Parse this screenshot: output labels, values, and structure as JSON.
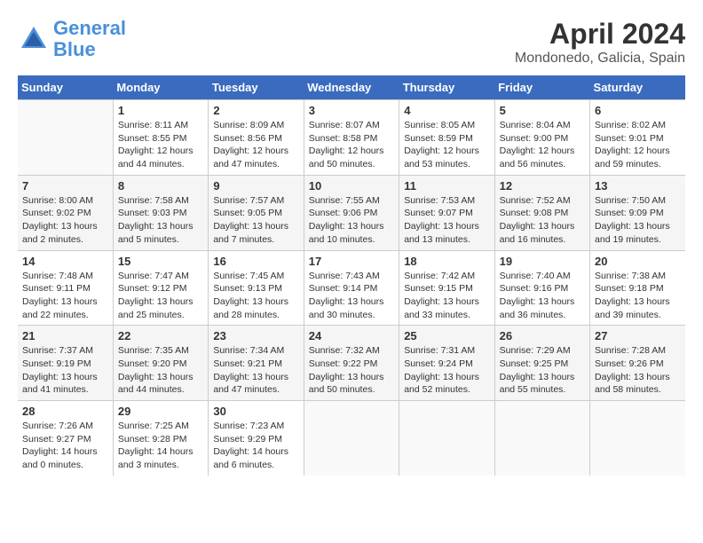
{
  "header": {
    "logo_line1": "General",
    "logo_line2": "Blue",
    "title": "April 2024",
    "subtitle": "Mondonedo, Galicia, Spain"
  },
  "days_of_week": [
    "Sunday",
    "Monday",
    "Tuesday",
    "Wednesday",
    "Thursday",
    "Friday",
    "Saturday"
  ],
  "weeks": [
    [
      {
        "day": "",
        "info": ""
      },
      {
        "day": "1",
        "info": "Sunrise: 8:11 AM\nSunset: 8:55 PM\nDaylight: 12 hours\nand 44 minutes."
      },
      {
        "day": "2",
        "info": "Sunrise: 8:09 AM\nSunset: 8:56 PM\nDaylight: 12 hours\nand 47 minutes."
      },
      {
        "day": "3",
        "info": "Sunrise: 8:07 AM\nSunset: 8:58 PM\nDaylight: 12 hours\nand 50 minutes."
      },
      {
        "day": "4",
        "info": "Sunrise: 8:05 AM\nSunset: 8:59 PM\nDaylight: 12 hours\nand 53 minutes."
      },
      {
        "day": "5",
        "info": "Sunrise: 8:04 AM\nSunset: 9:00 PM\nDaylight: 12 hours\nand 56 minutes."
      },
      {
        "day": "6",
        "info": "Sunrise: 8:02 AM\nSunset: 9:01 PM\nDaylight: 12 hours\nand 59 minutes."
      }
    ],
    [
      {
        "day": "7",
        "info": "Sunrise: 8:00 AM\nSunset: 9:02 PM\nDaylight: 13 hours\nand 2 minutes."
      },
      {
        "day": "8",
        "info": "Sunrise: 7:58 AM\nSunset: 9:03 PM\nDaylight: 13 hours\nand 5 minutes."
      },
      {
        "day": "9",
        "info": "Sunrise: 7:57 AM\nSunset: 9:05 PM\nDaylight: 13 hours\nand 7 minutes."
      },
      {
        "day": "10",
        "info": "Sunrise: 7:55 AM\nSunset: 9:06 PM\nDaylight: 13 hours\nand 10 minutes."
      },
      {
        "day": "11",
        "info": "Sunrise: 7:53 AM\nSunset: 9:07 PM\nDaylight: 13 hours\nand 13 minutes."
      },
      {
        "day": "12",
        "info": "Sunrise: 7:52 AM\nSunset: 9:08 PM\nDaylight: 13 hours\nand 16 minutes."
      },
      {
        "day": "13",
        "info": "Sunrise: 7:50 AM\nSunset: 9:09 PM\nDaylight: 13 hours\nand 19 minutes."
      }
    ],
    [
      {
        "day": "14",
        "info": "Sunrise: 7:48 AM\nSunset: 9:11 PM\nDaylight: 13 hours\nand 22 minutes."
      },
      {
        "day": "15",
        "info": "Sunrise: 7:47 AM\nSunset: 9:12 PM\nDaylight: 13 hours\nand 25 minutes."
      },
      {
        "day": "16",
        "info": "Sunrise: 7:45 AM\nSunset: 9:13 PM\nDaylight: 13 hours\nand 28 minutes."
      },
      {
        "day": "17",
        "info": "Sunrise: 7:43 AM\nSunset: 9:14 PM\nDaylight: 13 hours\nand 30 minutes."
      },
      {
        "day": "18",
        "info": "Sunrise: 7:42 AM\nSunset: 9:15 PM\nDaylight: 13 hours\nand 33 minutes."
      },
      {
        "day": "19",
        "info": "Sunrise: 7:40 AM\nSunset: 9:16 PM\nDaylight: 13 hours\nand 36 minutes."
      },
      {
        "day": "20",
        "info": "Sunrise: 7:38 AM\nSunset: 9:18 PM\nDaylight: 13 hours\nand 39 minutes."
      }
    ],
    [
      {
        "day": "21",
        "info": "Sunrise: 7:37 AM\nSunset: 9:19 PM\nDaylight: 13 hours\nand 41 minutes."
      },
      {
        "day": "22",
        "info": "Sunrise: 7:35 AM\nSunset: 9:20 PM\nDaylight: 13 hours\nand 44 minutes."
      },
      {
        "day": "23",
        "info": "Sunrise: 7:34 AM\nSunset: 9:21 PM\nDaylight: 13 hours\nand 47 minutes."
      },
      {
        "day": "24",
        "info": "Sunrise: 7:32 AM\nSunset: 9:22 PM\nDaylight: 13 hours\nand 50 minutes."
      },
      {
        "day": "25",
        "info": "Sunrise: 7:31 AM\nSunset: 9:24 PM\nDaylight: 13 hours\nand 52 minutes."
      },
      {
        "day": "26",
        "info": "Sunrise: 7:29 AM\nSunset: 9:25 PM\nDaylight: 13 hours\nand 55 minutes."
      },
      {
        "day": "27",
        "info": "Sunrise: 7:28 AM\nSunset: 9:26 PM\nDaylight: 13 hours\nand 58 minutes."
      }
    ],
    [
      {
        "day": "28",
        "info": "Sunrise: 7:26 AM\nSunset: 9:27 PM\nDaylight: 14 hours\nand 0 minutes."
      },
      {
        "day": "29",
        "info": "Sunrise: 7:25 AM\nSunset: 9:28 PM\nDaylight: 14 hours\nand 3 minutes."
      },
      {
        "day": "30",
        "info": "Sunrise: 7:23 AM\nSunset: 9:29 PM\nDaylight: 14 hours\nand 6 minutes."
      },
      {
        "day": "",
        "info": ""
      },
      {
        "day": "",
        "info": ""
      },
      {
        "day": "",
        "info": ""
      },
      {
        "day": "",
        "info": ""
      }
    ]
  ]
}
